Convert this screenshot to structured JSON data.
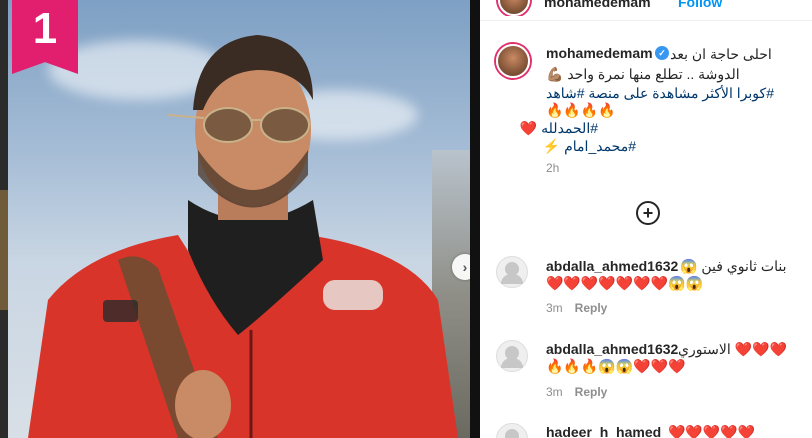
{
  "badge": {
    "label": "1"
  },
  "top_partial": {
    "username": "mohamedemam",
    "follow_label": "Follow"
  },
  "caption": {
    "username": "mohamedemam",
    "verified_mark": "✓",
    "lines": [
      "احلى حاجة ان بعد",
      "الدوشة .. تطلع منها نمرة واحد 💪🏽",
      "#كوبرا الأكثر مشاهدة على منصة #شاهد",
      "🔥🔥🔥🔥",
      "#الحمدلله ❤️",
      "#محمد_امام ⚡"
    ],
    "time": "2h"
  },
  "load_more": {
    "icon": "plus-circle-icon",
    "glyph": "+"
  },
  "comments": [
    {
      "username": "abdalla_ahmed1632",
      "text": "بنات ثانوي فين 😱",
      "emoji_line": "❤️❤️❤️❤️❤️❤️❤️😱😱",
      "time": "3m",
      "reply_label": "Reply"
    },
    {
      "username": "abdalla_ahmed1632",
      "text": "❤️❤️❤️ الاستوري",
      "emoji_line": "🔥🔥🔥😱😱❤️❤️❤️",
      "time": "3m",
      "reply_label": "Reply"
    },
    {
      "username": "hadeer_h_hamed",
      "text": "❤️❤️❤️❤️❤️"
    }
  ],
  "colors": {
    "badge": "#e21f6f",
    "link": "#00376b",
    "follow": "#0095f6",
    "story_ring": "#e1306c"
  }
}
